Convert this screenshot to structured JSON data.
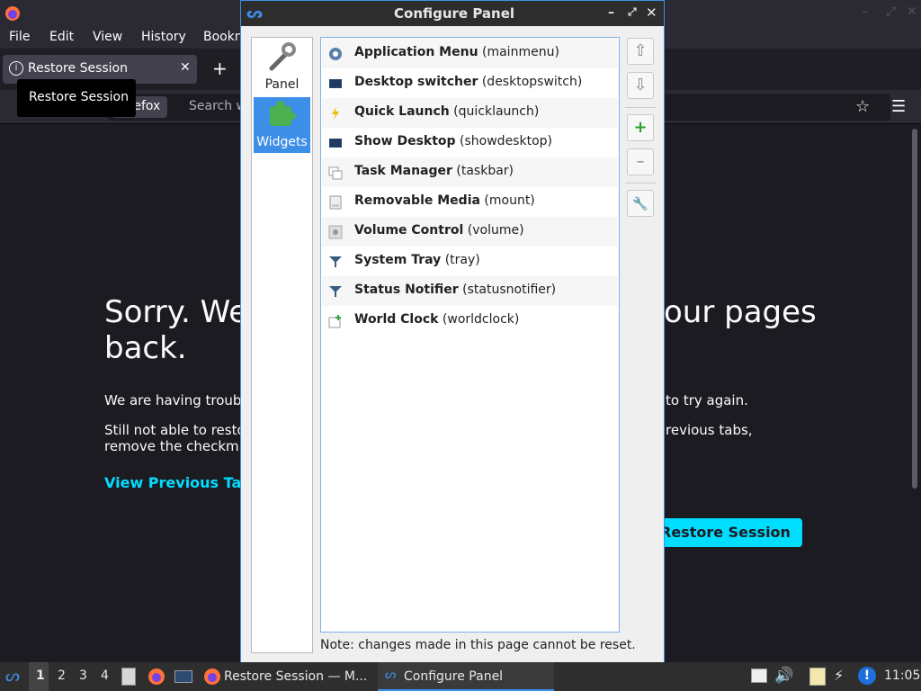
{
  "firefox": {
    "menu": [
      "File",
      "Edit",
      "View",
      "History",
      "Bookm"
    ],
    "tab_label": "Restore Session",
    "tooltip": "Restore Session",
    "url_pill": "Firefox",
    "url_text": "Search w",
    "heading": "Sorry. We",
    "heading_right": "our pages",
    "heading_line2": "back.",
    "p1_left": "We are having troub",
    "p1_right": "to try again.",
    "p2_left": "Still not able to resto",
    "p2_right": "revious tabs,",
    "p3_left": "remove the checkm",
    "view_prev": "View Previous Tab",
    "restore_btn": "Restore Session"
  },
  "dialog": {
    "title": "Configure Panel",
    "side": [
      {
        "label": "Panel",
        "icon": "wrench-icon"
      },
      {
        "label": "Widgets",
        "icon": "puzzle-icon"
      }
    ],
    "widgets": [
      {
        "name": "Application Menu",
        "id": "(mainmenu)",
        "icon": "app-menu-icon"
      },
      {
        "name": "Desktop switcher",
        "id": "(desktopswitch)",
        "icon": "desktop-icon"
      },
      {
        "name": "Quick Launch",
        "id": "(quicklaunch)",
        "icon": "lightning-icon"
      },
      {
        "name": "Show Desktop",
        "id": "(showdesktop)",
        "icon": "desktop-icon"
      },
      {
        "name": "Task Manager",
        "id": "(taskbar)",
        "icon": "windows-icon"
      },
      {
        "name": "Removable Media",
        "id": "(mount)",
        "icon": "drive-icon"
      },
      {
        "name": "Volume Control",
        "id": "(volume)",
        "icon": "speaker-icon"
      },
      {
        "name": "System Tray",
        "id": "(tray)",
        "icon": "funnel-icon"
      },
      {
        "name": "Status Notifier",
        "id": "(statusnotifier)",
        "icon": "funnel-icon"
      },
      {
        "name": "World Clock",
        "id": "(worldclock)",
        "icon": "clock-add-icon"
      }
    ],
    "note": "Note: changes made in this page cannot be reset."
  },
  "taskbar": {
    "workspaces": [
      "1",
      "2",
      "3",
      "4"
    ],
    "task1": "Restore Session — M...",
    "task2": "Configure Panel",
    "clock": "11:05"
  },
  "colors": {
    "accent": "#3d8ee6",
    "ff_bg": "#1c1b22",
    "link": "#00ddff"
  }
}
